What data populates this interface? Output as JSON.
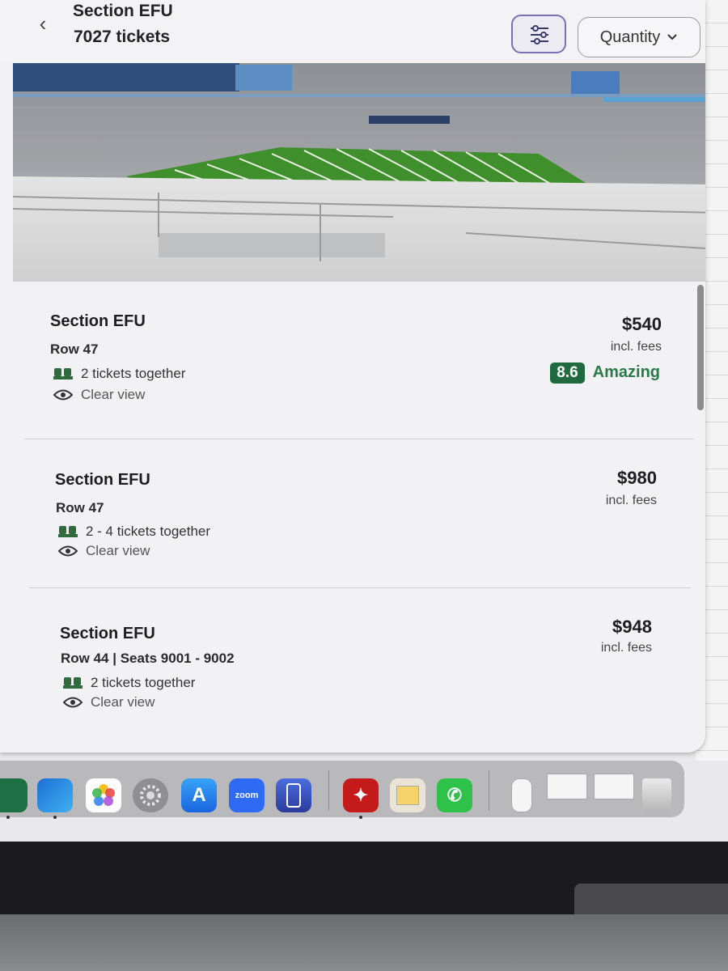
{
  "header": {
    "back_icon": "chevron-left-icon",
    "title": "Section EFU",
    "subtitle": "7027 tickets",
    "filter_icon": "sliders-icon",
    "quantity_label": "Quantity",
    "quantity_icon": "chevron-down-icon"
  },
  "stadium": {
    "image": "stadium-view",
    "field_color": "#3d8a2a",
    "stands_color": "#c9c9c9"
  },
  "listings": [
    {
      "section": "Section EFU",
      "row": "Row 47",
      "tickets": "2 tickets together",
      "view": "Clear view",
      "price": "$540",
      "fees": "incl. fees",
      "score": "8.6",
      "score_label": "Amazing"
    },
    {
      "section": "Section EFU",
      "row": "Row 47",
      "tickets": "2 - 4 tickets together",
      "view": "Clear view",
      "price": "$980",
      "fees": "incl. fees"
    },
    {
      "section": "Section EFU",
      "row": "Row 44 | Seats 9001 - 9002",
      "tickets": "2 tickets together",
      "view": "Clear view",
      "price": "$948",
      "fees": "incl. fees"
    }
  ],
  "colors": {
    "score_badge": "#1f6b3f",
    "score_text": "#2a7a4a",
    "filter_border": "#7a6fb0"
  },
  "dock": {
    "items": [
      "Excel",
      "Outlook",
      "Photos",
      "System Settings",
      "App Store",
      "zoom",
      "Simulator",
      "Acrobat",
      "Preview",
      "Phone",
      "Document",
      "Word Document",
      "Word Document",
      "Trash"
    ],
    "zoom_label": "zoom"
  }
}
